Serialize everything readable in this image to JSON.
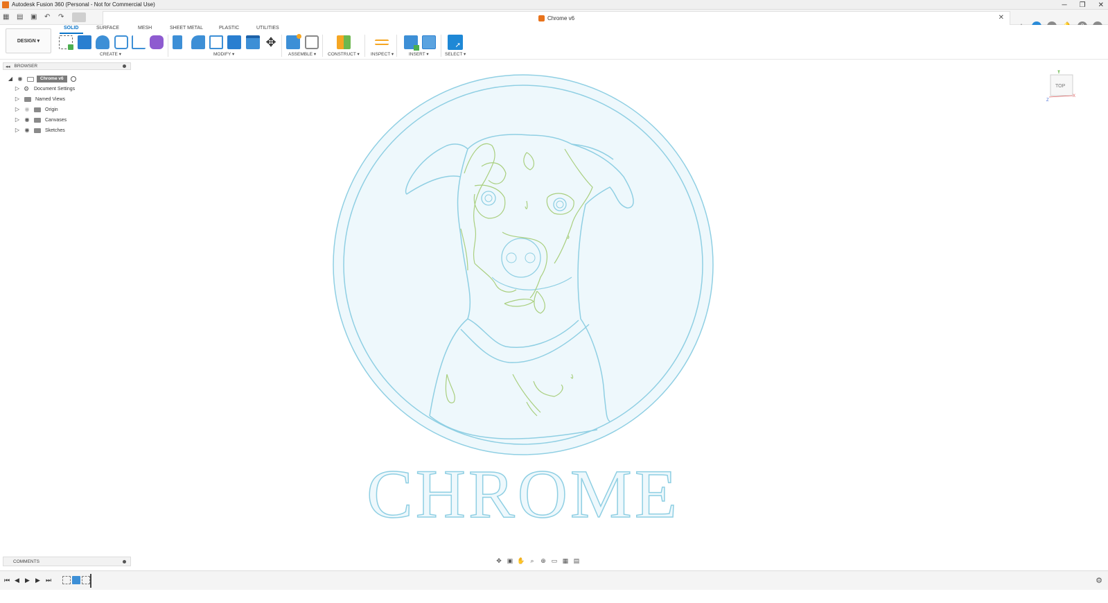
{
  "window": {
    "title": "Autodesk Fusion 360 (Personal - Not for Commercial Use)",
    "minimize": "─",
    "maximize": "❐",
    "close": "✕"
  },
  "document_tab": {
    "title": "Chrome v6",
    "close": "✕"
  },
  "workspace": {
    "button_label": "DESIGN ▾",
    "tabs": [
      "SOLID",
      "SURFACE",
      "MESH",
      "SHEET METAL",
      "PLASTIC",
      "UTILITIES"
    ],
    "active_tab": "SOLID"
  },
  "tool_groups": {
    "create": "CREATE ▾",
    "modify": "MODIFY ▾",
    "assemble": "ASSEMBLE ▾",
    "construct": "CONSTRUCT ▾",
    "inspect": "INSPECT ▾",
    "insert": "INSERT ▾",
    "select": "SELECT ▾"
  },
  "browser": {
    "collapse": "◂◂",
    "header": "BROWSER",
    "root": "Chrome v6",
    "items": [
      {
        "label": "Document Settings",
        "icon": "gear-icon"
      },
      {
        "label": "Named Views",
        "icon": "folder-icon"
      },
      {
        "label": "Origin",
        "icon": "folder-icon"
      },
      {
        "label": "Canvases",
        "icon": "folder-icon"
      },
      {
        "label": "Sketches",
        "icon": "folder-icon"
      }
    ]
  },
  "viewcube": {
    "face": "TOP",
    "axis_y": "Y",
    "axis_x": "X",
    "axis_z": "Z"
  },
  "sketch": {
    "text": "CHROME",
    "colors": {
      "fill": "#eef8fc",
      "outline": "#8fcfe3",
      "sketch_lines": "#a9cf7f"
    }
  },
  "comments": {
    "header": "COMMENTS"
  },
  "colors": {
    "accent": "#0a74c8",
    "app_orange": "#e8731c"
  }
}
